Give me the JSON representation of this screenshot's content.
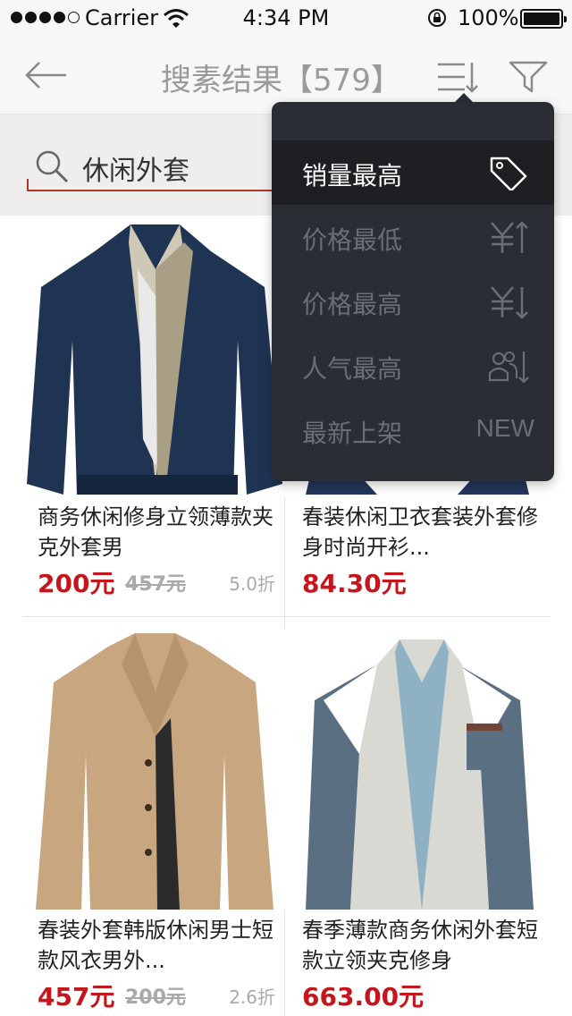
{
  "status_bar": {
    "carrier": "Carrier",
    "time": "4:34 PM",
    "battery": "100%"
  },
  "nav": {
    "title": "搜素结果【579】",
    "back_icon": "arrow-left-icon",
    "sort_icon": "sort-list-icon",
    "filter_icon": "filter-funnel-icon"
  },
  "search": {
    "value": "休闲外套",
    "icon": "search-icon"
  },
  "sort_menu": {
    "items": [
      {
        "label": "销量最高",
        "icon": "price-tag-icon",
        "active": true
      },
      {
        "label": "价格最低",
        "icon": "yuan-sort-up-icon",
        "active": false
      },
      {
        "label": "价格最高",
        "icon": "yuan-sort-down-icon",
        "active": false
      },
      {
        "label": "人气最高",
        "icon": "people-sort-icon",
        "active": false
      },
      {
        "label": "最新上架",
        "icon_text": "NEW",
        "active": false
      }
    ]
  },
  "products": [
    {
      "name": "商务休闲修身立领薄款夹克外套男",
      "price": "200元",
      "original_price": "457元",
      "discount": "5.0折",
      "image": "navy-jacket-photo"
    },
    {
      "name": "春装休闲卫衣套装外套修身时尚开衫...",
      "price": "84.30元",
      "original_price": "",
      "discount": "",
      "image": "navy-hoodie-photo"
    },
    {
      "name": "春装外套韩版休闲男士短款风衣男外...",
      "price": "457元",
      "original_price": "200元",
      "discount": "2.6折",
      "image": "khaki-trench-photo"
    },
    {
      "name": "春季薄款商务休闲外套短款立领夹克修身",
      "price": "663.00元",
      "original_price": "",
      "discount": "",
      "image": "grey-jacket-photo"
    }
  ],
  "colors": {
    "accent": "#c4161c",
    "menu_bg": "#2a2d33",
    "menu_active": "#1d1f23"
  }
}
